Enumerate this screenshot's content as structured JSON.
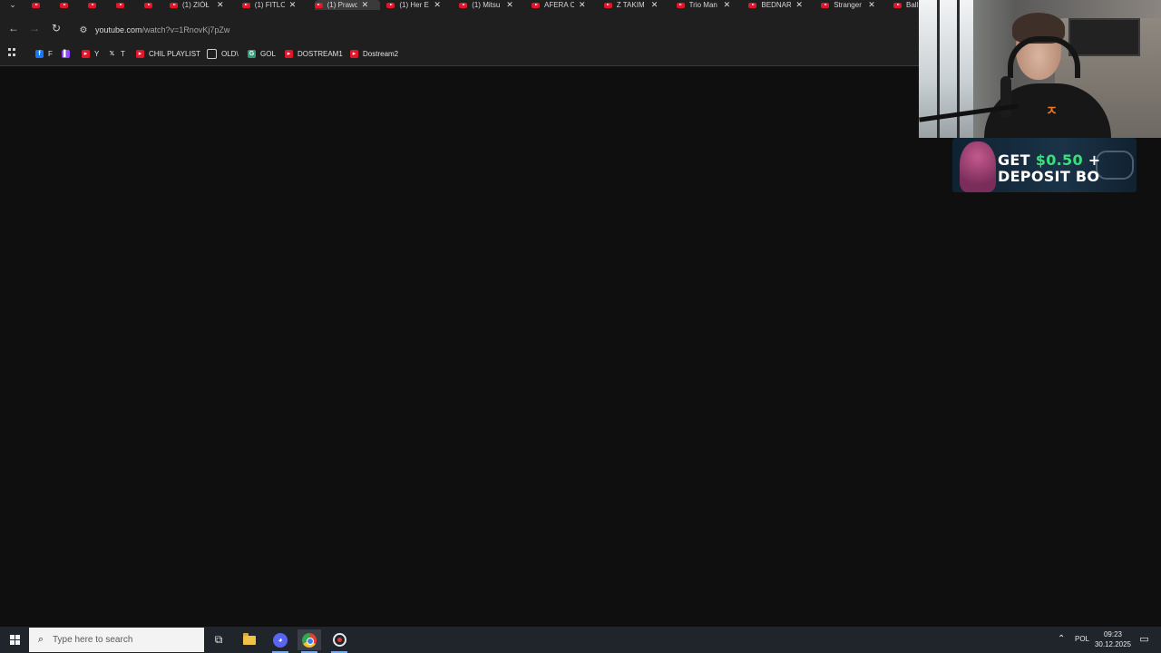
{
  "browser": {
    "tabs": [
      {
        "label": "",
        "active": false
      },
      {
        "label": "",
        "active": false
      },
      {
        "label": "",
        "active": false
      },
      {
        "label": "",
        "active": false
      },
      {
        "label": "",
        "active": false
      },
      {
        "label": "(1) ZIÓŁ",
        "active": false
      },
      {
        "label": "(1) FITLO",
        "active": false
      },
      {
        "label": "(1) Prawd",
        "active": true
      },
      {
        "label": "(1) Her E",
        "active": false
      },
      {
        "label": "(1) Mitsu",
        "active": false
      },
      {
        "label": "AFERA C",
        "active": false
      },
      {
        "label": "Z TAKIM",
        "active": false
      },
      {
        "label": "Trio Man",
        "active": false
      },
      {
        "label": "BEDNAR",
        "active": false
      },
      {
        "label": "Stranger",
        "active": false
      },
      {
        "label": "Ball",
        "active": false
      }
    ],
    "tab_close_glyph": "✕",
    "url_host": "youtube.com",
    "url_path": "/watch?v=1RnovKj7pZw",
    "bookmarks": [
      {
        "label": "F",
        "icon": "facebook-icon",
        "color": "#1877f2"
      },
      {
        "label": "",
        "icon": "twitch-icon",
        "color": "#9146ff"
      },
      {
        "label": "Y",
        "icon": "youtube-icon",
        "color": "#e0162b"
      },
      {
        "label": "T",
        "icon": "x-icon",
        "color": "#1f1f1f"
      },
      {
        "label": "CHIL PLAYLIST",
        "icon": "youtube-icon",
        "color": "#e0162b"
      },
      {
        "label": "OLD\\",
        "icon": "folder-icon",
        "color": "#1f1f1f"
      },
      {
        "label": "GOL",
        "icon": "g-icon",
        "color": "#2aa07a"
      },
      {
        "label": "DOSTREAM1",
        "icon": "youtube-icon",
        "color": "#e0162b"
      },
      {
        "label": "Dostream2",
        "icon": "youtube-icon",
        "color": "#e0162b"
      }
    ]
  },
  "overlay": {
    "ad_line1_a": "GET",
    "ad_line1_b": "$0.50",
    "ad_line1_c": "+",
    "ad_line2": "DEPOSIT BO"
  },
  "taskbar": {
    "search_placeholder": "Type here to search",
    "language": "POL",
    "time": "09:23",
    "date": "30.12.2025"
  }
}
